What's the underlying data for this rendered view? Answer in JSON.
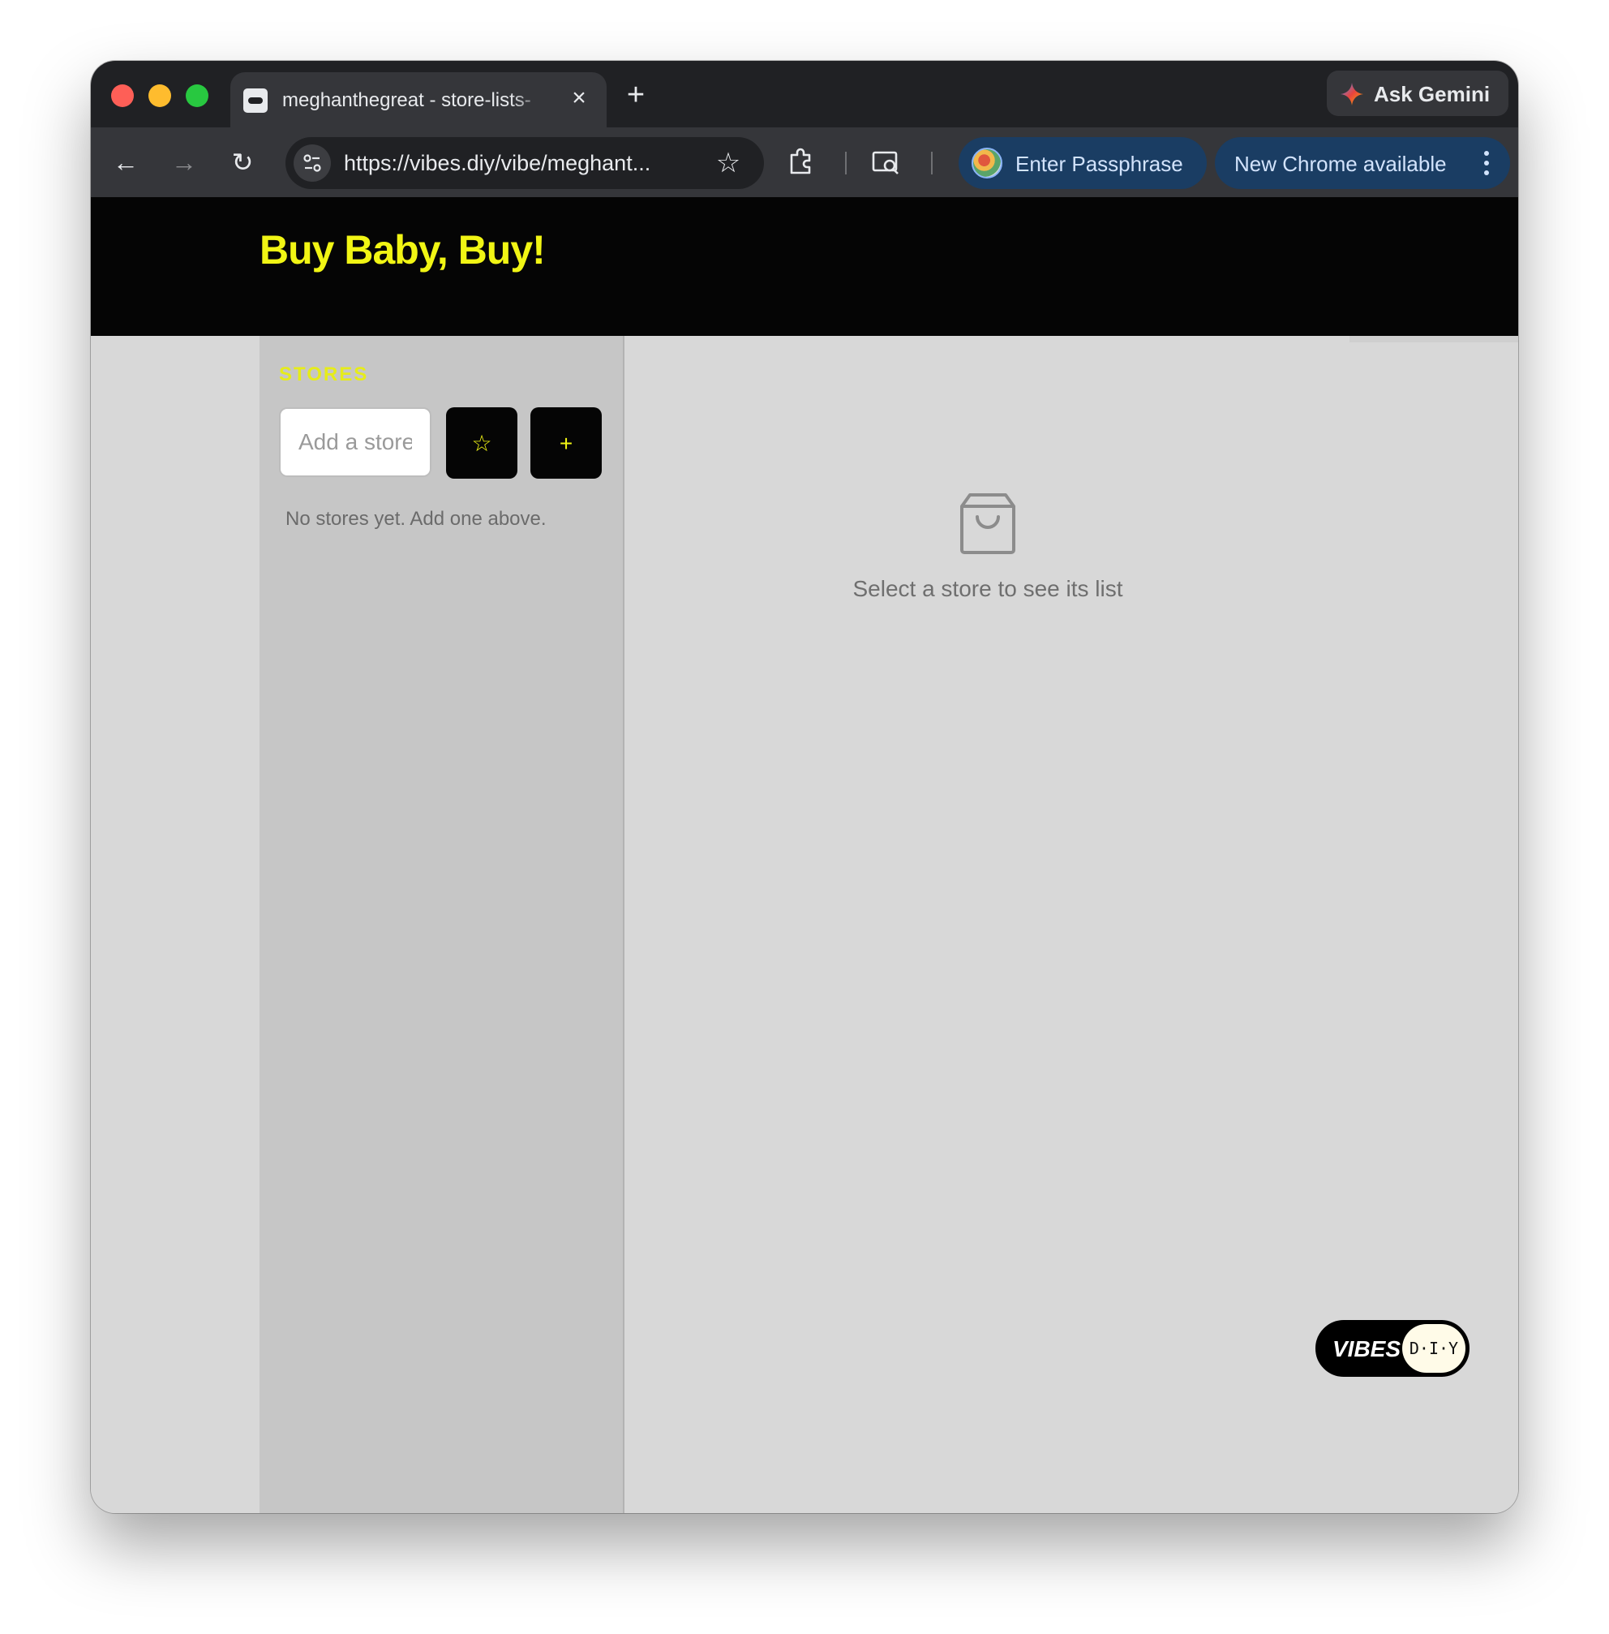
{
  "browser": {
    "tab": {
      "title": "meghanthegreat - store-lists-",
      "close_icon": "close-icon",
      "favicon": "app-favicon"
    },
    "new_tab_icon": "plus-icon",
    "gemini": {
      "label": "Ask Gemini",
      "icon": "gemini-sparkle-icon"
    },
    "nav": {
      "back": "arrow-left-icon",
      "forward": "arrow-right-icon",
      "reload": "reload-icon"
    },
    "address_bar": {
      "url": "https://vibes.diy/vibe/meghant...",
      "site_settings_icon": "tune-icon",
      "bookmark_icon": "star-icon"
    },
    "extensions_icon": "puzzle-icon",
    "lens_icon": "search-page-icon",
    "profile_pill": {
      "label": "Enter Passphrase"
    },
    "update_pill": {
      "label": "New Chrome available",
      "menu_icon": "more-vert-icon"
    }
  },
  "app": {
    "title": "Buy Baby, Buy!",
    "accent_color": "#f1f514",
    "sidebar": {
      "heading": "STORES",
      "input_placeholder": "Add a store",
      "favorite_button_label": "☆",
      "add_button_label": "+",
      "empty_message": "No stores yet. Add one above."
    },
    "main": {
      "empty_icon": "shopping-bag-icon",
      "empty_message": "Select a store to see its list"
    },
    "badge": {
      "brand": "VIBES",
      "suffix": "D·I·Y"
    }
  }
}
